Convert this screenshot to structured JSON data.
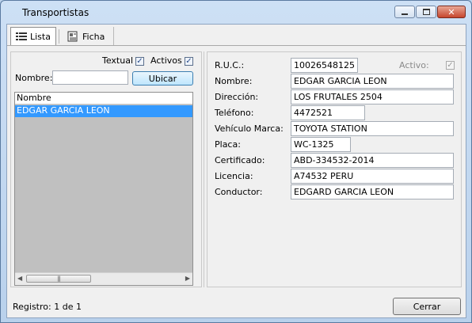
{
  "window": {
    "title": "Transportistas",
    "close_glyph": "✕"
  },
  "tabs": [
    {
      "label": "Lista",
      "icon": "list-icon",
      "active": true
    },
    {
      "label": "Ficha",
      "icon": "card-icon",
      "active": false
    }
  ],
  "list_panel": {
    "textual_label": "Textual",
    "textual_checked": true,
    "activos_label": "Activos",
    "activos_checked": true,
    "nombre_label": "Nombre:",
    "nombre_value": "",
    "ubicar_label": "Ubicar",
    "column_header": "Nombre",
    "rows": [
      "EDGAR  GARCIA LEON"
    ]
  },
  "detail": {
    "ruc_label": "R.U.C.:",
    "ruc_value": "10026548125",
    "activo_label": "Activo:",
    "activo_checked": true,
    "nombre_label": "Nombre:",
    "nombre_value": "EDGAR  GARCIA LEON",
    "direccion_label": "Dirección:",
    "direccion_value": "LOS FRUTALES 2504",
    "telefono_label": "Teléfono:",
    "telefono_value": "4472521",
    "vehiculo_label": "Vehículo Marca:",
    "vehiculo_value": "TOYOTA STATION",
    "placa_label": "Placa:",
    "placa_value": "WC-1325",
    "certificado_label": "Certificado:",
    "certificado_value": "ABD-334532-2014",
    "licencia_label": "Licencia:",
    "licencia_value": "A74532 PERU",
    "conductor_label": "Conductor:",
    "conductor_value": "EDGARD GARCIA LEON"
  },
  "footer": {
    "status": "Registro: 1 de 1",
    "cerrar_label": "Cerrar"
  },
  "colors": {
    "selection": "#3399ff",
    "list_background": "#c0c0c0"
  }
}
